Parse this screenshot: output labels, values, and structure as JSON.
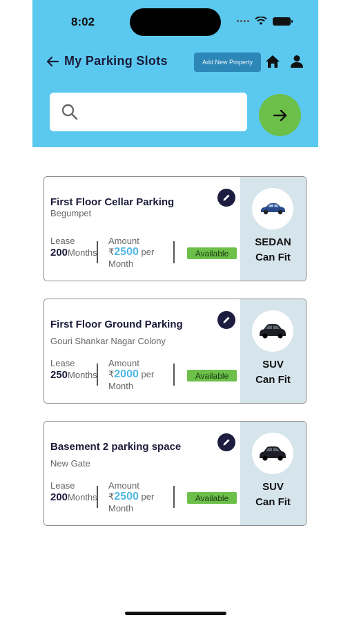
{
  "status_bar": {
    "time": "8:02"
  },
  "header": {
    "title": "My Parking Slots",
    "add_button_label": "Add New Property"
  },
  "search": {
    "value": "",
    "placeholder": ""
  },
  "cards": [
    {
      "title": "First Floor Cellar Parking",
      "location": "Begumpet",
      "lease_label": "Lease",
      "lease_value": "200",
      "lease_unit": "Months",
      "amount_label": "Amount",
      "currency": "₹",
      "amount_value": "2500",
      "per": "per",
      "month": "Month",
      "status": "Available",
      "car_type": "SEDAN",
      "fit_label": "Can Fit",
      "car_icon": "sedan-car-icon"
    },
    {
      "title": "First Floor Ground Parking",
      "location": "Gouri Shankar Nagar Colony",
      "lease_label": "Lease",
      "lease_value": "250",
      "lease_unit": "Months",
      "amount_label": "Amount",
      "currency": "₹",
      "amount_value": "2000",
      "per": "per",
      "month": "Month",
      "status": "Available",
      "car_type": "SUV",
      "fit_label": "Can Fit",
      "car_icon": "suv-car-icon"
    },
    {
      "title": "Basement 2 parking space",
      "location": "New Gate",
      "lease_label": "Lease",
      "lease_value": "200",
      "lease_unit": "Months",
      "amount_label": "Amount",
      "currency": "₹",
      "amount_value": "2500",
      "per": "per",
      "month": "Month",
      "status": "Available",
      "car_type": "SUV",
      "fit_label": "Can Fit",
      "car_icon": "suv-car-icon"
    }
  ],
  "colors": {
    "header_bg": "#5bc8ef",
    "accent_green": "#6cc04a",
    "amount_blue": "#4fb8e2",
    "title_navy": "#1b1b3a",
    "add_button_bg": "#2d86b8"
  }
}
